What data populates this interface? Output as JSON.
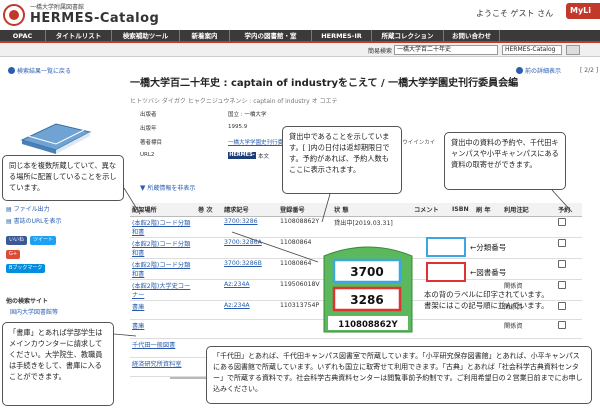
{
  "header": {
    "brand_sub": "一橋大学附属図書館",
    "brand": "HERMES-Catalog",
    "welcome": "ようこそ ゲスト さん",
    "mylib": "MyLi"
  },
  "nav": [
    "OPAC",
    "タイトルリスト",
    "検索補助ツール",
    "新着案内",
    "学内の図書館・室",
    "HERMES-IR",
    "所蔵コレクション",
    "お問い合わせ"
  ],
  "search": {
    "label": "簡易検索",
    "value": "一橋大学百二十年史",
    "scope": "HERMES-Catalog"
  },
  "links": {
    "back": "検索結果一覧に戻る",
    "detail": "前の詳細表示",
    "pager": "[ 2/2 ]",
    "toggle_holdings": "所蔵情報を非表示"
  },
  "record": {
    "title": "一橋大学百二十年史 : captain of industryをこえて / 一橋大学学園史刊行委員会編",
    "title_yomi": "ヒトツバシ ダイガク ヒャクニジュウネンシ : captain of industry オ コエテ",
    "meta": [
      {
        "key": "出版者",
        "value": "国立 : 一橋大学"
      },
      {
        "key": "出版年",
        "value": "1995.9"
      },
      {
        "key": "著者標目",
        "value": "一橋大学学園史刊行委員会"
      },
      {
        "key": "URL2",
        "value": "HERMES-IR"
      }
    ],
    "yomi_frag": "コンコウイインカイ",
    "url_suffix": "本文"
  },
  "sidebar": {
    "items": [
      "ファイル出力",
      "書誌のURLを表示"
    ],
    "social": [
      "いいね",
      "ツイート",
      "G+",
      "Bブックマーク"
    ],
    "other_title": "他の検索サイト",
    "other_item": "国内大学図書館等"
  },
  "holdings": {
    "headers": [
      "配架場所",
      "巻 次",
      "請求記号",
      "登録番号",
      "状 態",
      "コメント",
      "ISBN",
      "刷 年",
      "利用注記",
      "予約"
    ],
    "rows": [
      {
        "loc": "(本館2階)コード分類和書",
        "call": "3700:3286",
        "reg": "110808862Y",
        "status": "貸出中[2019.03.31]"
      },
      {
        "loc": "(本館2階)コード分類和書",
        "call": "3700:3286A",
        "reg": "11080864",
        "status": ""
      },
      {
        "loc": "(本館2階)コード分類和書",
        "call": "3700:3286B",
        "reg": "11080864",
        "status": ""
      },
      {
        "loc": "(本館2階)大学史コーナー",
        "call": "Az:234A",
        "reg": "119506018V",
        "status": ""
      },
      {
        "loc": "書庫",
        "call": "Az:234A",
        "reg": "110313754P",
        "status": ""
      },
      {
        "loc": "書庫",
        "call": "",
        "reg": "",
        "status": ""
      },
      {
        "loc": "千代田一般図書",
        "call": "",
        "reg": "",
        "status": ""
      },
      {
        "loc": "経済研究所資料室",
        "call": "",
        "reg": "",
        "status": ""
      }
    ],
    "note_frag": "関係資"
  },
  "callouts": {
    "multi_copy": "同じ本を複数所蔵していて、異なる場所に配置していることを示しています。",
    "loan": "貸出中であることを示しています。[ ]内の日付は返却期限日です。予約があれば、予約人数もここに表示されます。",
    "reserve": "貸出中の資料の予約や、千代田キャンパスや小平キャンパスにある資料の取寄せができます。",
    "stack": "「書庫」とあれば学部学生はメインカウンターに請求してください。大学院生、教職員は手続きをして、書庫に入ることができます。",
    "campus": "「千代田」とあれば、千代田キャンパス図書室で所蔵しています。「小平研究保存図書館」とあれば、小平キャンパスにある図書館で所蔵しています。いずれも国立に取寄せて利用できます。「古典」とあれば「社会科学古典資料センター」で所蔵する資料です。社会科学古典資料センターは閲覧事前予約制です。ご利用希望日の２営業日前までにお申し込みください。"
  },
  "label_fig": {
    "classification_no": "3700",
    "book_no": "3286",
    "reg_no": "110808862Y",
    "legend_class": "←分類番号",
    "legend_book": "←図書番号",
    "explain": "本の背のラベルに印字されています。書架にはこの記号順に並んでいます。"
  },
  "colors": {
    "accent": "#c0392b",
    "link": "#2a5db0",
    "label_green": "#4aa84a",
    "label_blue": "#3aa7e0",
    "label_red": "#d33"
  }
}
